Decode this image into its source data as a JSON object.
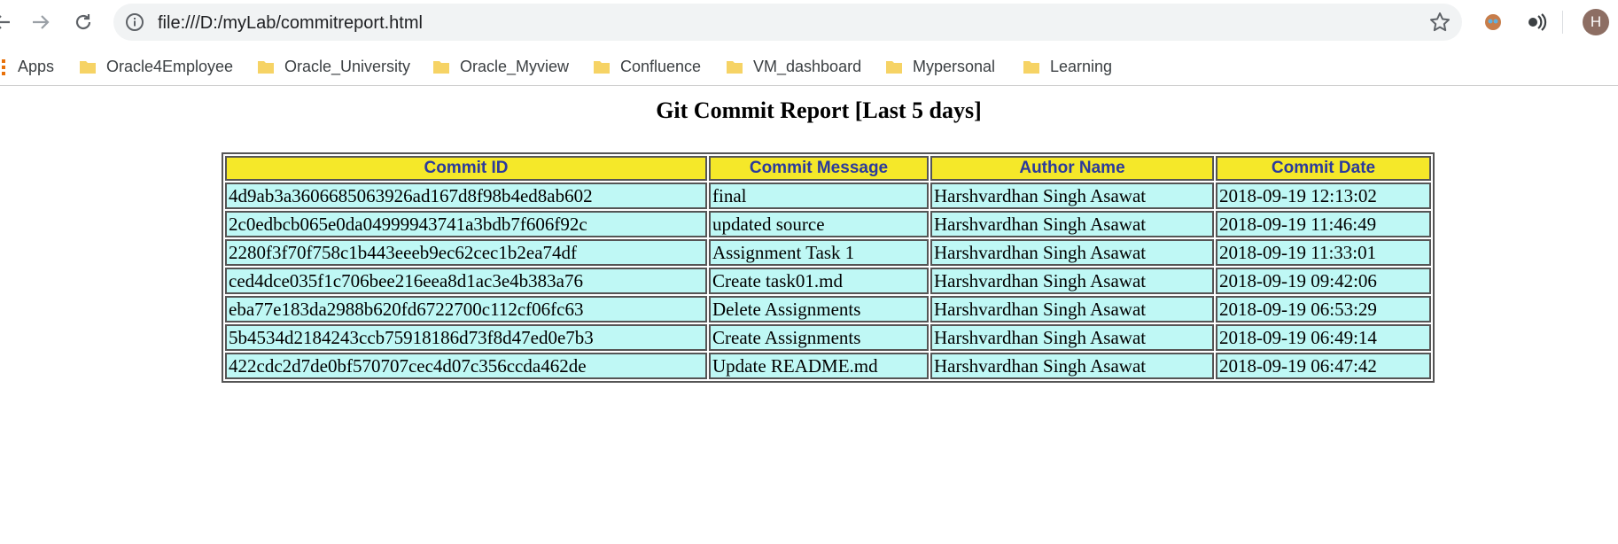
{
  "browser": {
    "url": "file:///D:/myLab/commitreport.html",
    "avatar_letter": "H"
  },
  "bookmarks": {
    "apps_label": "Apps",
    "items": [
      {
        "label": "Oracle4Employee"
      },
      {
        "label": "Oracle_University"
      },
      {
        "label": "Oracle_Myview"
      },
      {
        "label": "Confluence"
      },
      {
        "label": "VM_dashboard"
      },
      {
        "label": "Mypersonal"
      },
      {
        "label": "Learning"
      }
    ]
  },
  "page": {
    "title": "Git Commit Report [Last 5 days]"
  },
  "table": {
    "headers": [
      "Commit ID",
      "Commit Message",
      "Author Name",
      "Commit Date"
    ],
    "rows": [
      [
        "4d9ab3a3606685063926ad167d8f98b4ed8ab602",
        "final",
        "Harshvardhan Singh Asawat",
        "2018-09-19 12:13:02"
      ],
      [
        "2c0edbcb065e0da04999943741a3bdb7f606f92c",
        "updated source",
        "Harshvardhan Singh Asawat",
        "2018-09-19 11:46:49"
      ],
      [
        "2280f3f70f758c1b443eeeb9ec62cec1b2ea74df",
        "Assignment Task 1",
        "Harshvardhan Singh Asawat",
        "2018-09-19 11:33:01"
      ],
      [
        "ced4dce035f1c706bee216eea8d1ac3e4b383a76",
        "Create task01.md",
        "Harshvardhan Singh Asawat",
        "2018-09-19 09:42:06"
      ],
      [
        "eba77e183da2988b620fd6722700c112cf06fc63",
        "Delete Assignments",
        "Harshvardhan Singh Asawat",
        "2018-09-19 06:53:29"
      ],
      [
        "5b4534d2184243ccb75918186d73f8d47ed0e7b3",
        "Create Assignments",
        "Harshvardhan Singh Asawat",
        "2018-09-19 06:49:14"
      ],
      [
        "422cdc2d7de0bf570707cec4d07c356ccda462de",
        "Update README.md",
        "Harshvardhan Singh Asawat",
        "2018-09-19 06:47:42"
      ]
    ]
  },
  "colors": {
    "header_bg": "#f5e829",
    "header_text": "#2b3a9d",
    "cell_bg": "#bff8f5",
    "folder": "#f6d365"
  }
}
